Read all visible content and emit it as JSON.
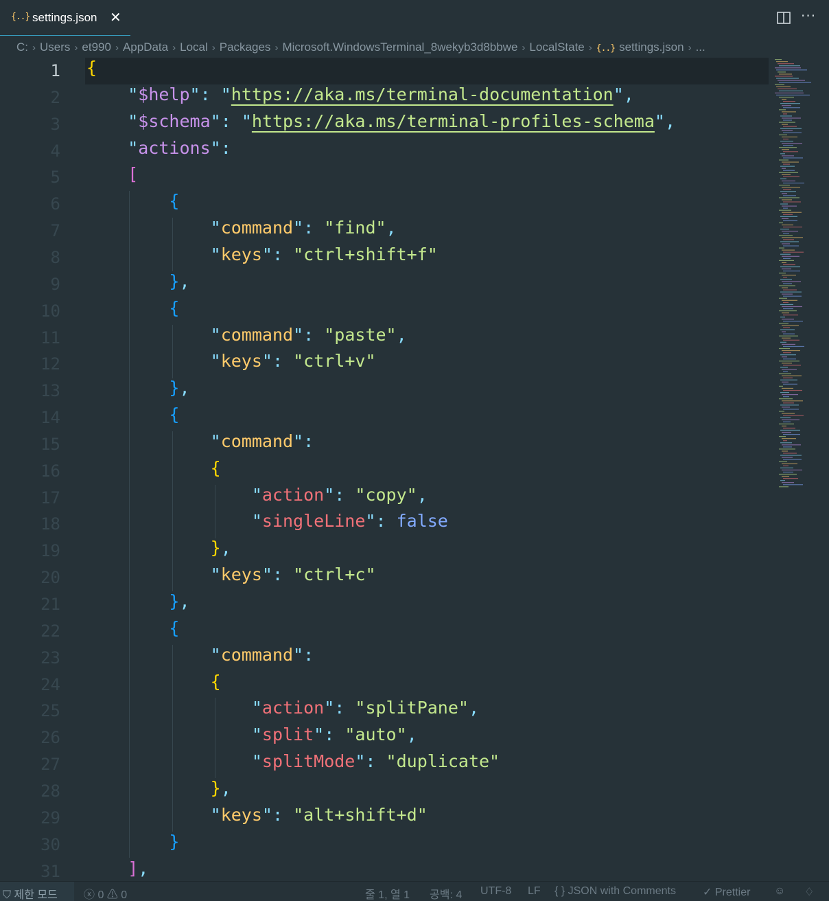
{
  "tab": {
    "icon": "json-braces-icon",
    "icon_text": "{..}",
    "label": "settings.json",
    "close": "✕"
  },
  "tab_actions": {
    "split_editor": "split-editor-icon",
    "more": "···"
  },
  "breadcrumbs": [
    {
      "label": "C:"
    },
    {
      "label": "Users"
    },
    {
      "label": "et990"
    },
    {
      "label": "AppData"
    },
    {
      "label": "Local"
    },
    {
      "label": "Packages"
    },
    {
      "label": "Microsoft.WindowsTerminal_8wekyb3d8bbwe"
    },
    {
      "label": "LocalState"
    },
    {
      "label": "settings.json",
      "icon": "{..}"
    },
    {
      "label": "..."
    }
  ],
  "editor": {
    "active_line": 1,
    "line_numbers": [
      "1",
      "2",
      "3",
      "4",
      "5",
      "6",
      "7",
      "8",
      "9",
      "10",
      "11",
      "12",
      "13",
      "14",
      "15",
      "16",
      "17",
      "18",
      "19",
      "20",
      "21",
      "22",
      "23",
      "24",
      "25",
      "26",
      "27",
      "28",
      "29",
      "30",
      "31"
    ],
    "lines": [
      "{",
      "    \"$help\": \"https://aka.ms/terminal-documentation\",",
      "    \"$schema\": \"https://aka.ms/terminal-profiles-schema\",",
      "    \"actions\":",
      "    [",
      "        {",
      "            \"command\": \"find\",",
      "            \"keys\": \"ctrl+shift+f\"",
      "        },",
      "        {",
      "            \"command\": \"paste\",",
      "            \"keys\": \"ctrl+v\"",
      "        },",
      "        {",
      "            \"command\":",
      "            {",
      "                \"action\": \"copy\",",
      "                \"singleLine\": false",
      "            },",
      "            \"keys\": \"ctrl+c\"",
      "        },",
      "        {",
      "            \"command\":",
      "            {",
      "                \"action\": \"splitPane\",",
      "                \"split\": \"auto\",",
      "                \"splitMode\": \"duplicate\"",
      "            },",
      "            \"keys\": \"alt+shift+d\"",
      "        }",
      "    ],"
    ]
  },
  "statusbar": {
    "restricted_mode": "제한 모드",
    "errors": "0",
    "warnings": "0",
    "cursor": "줄 1, 열 1",
    "spaces": "공백: 4",
    "encoding": "UTF-8",
    "eol": "LF",
    "language": "JSON with Comments",
    "formatter": "Prettier"
  },
  "colors": {
    "background": "#263238",
    "key_purple": "#c792ea",
    "key_yellow": "#ffcb6b",
    "key_red": "#f07178",
    "string": "#c3e88d",
    "punctuation": "#89ddff",
    "bracket_level1": "#ffd700",
    "bracket_level2": "#da70d6",
    "bracket_level3": "#179fff",
    "tab_accent": "#37a3c7"
  }
}
